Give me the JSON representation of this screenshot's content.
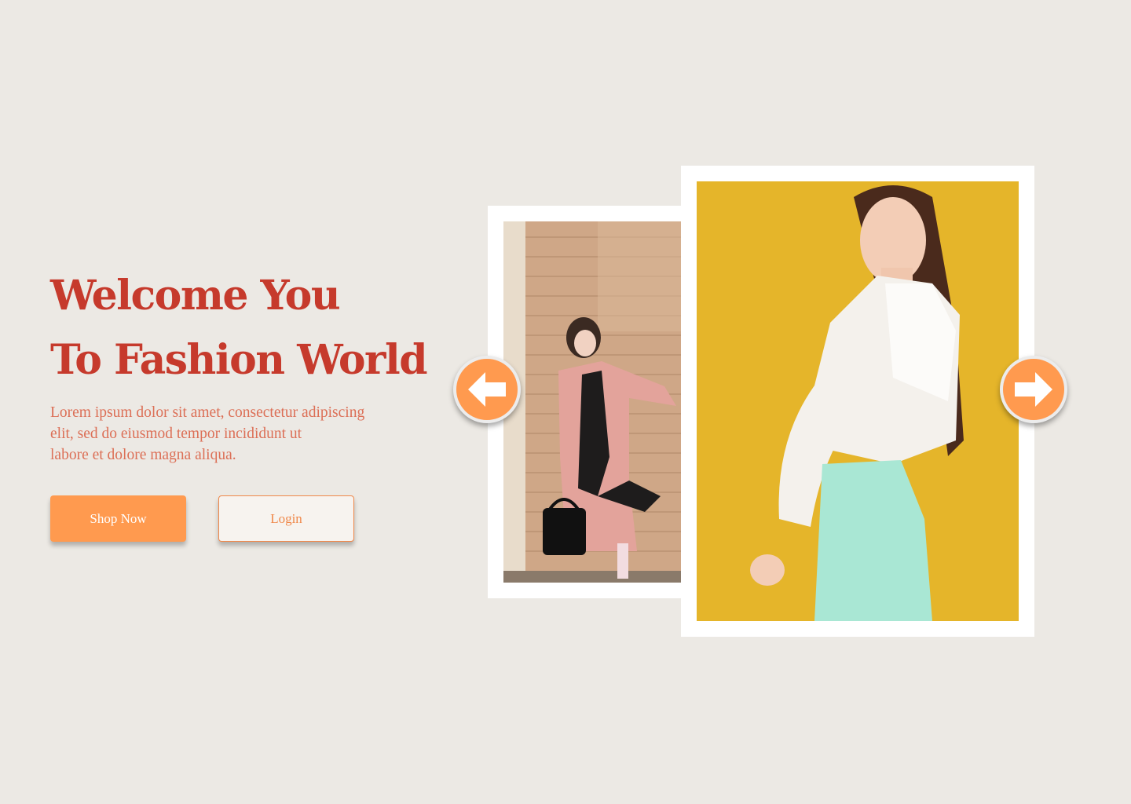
{
  "hero": {
    "title_line1": "Welcome You",
    "title_line2": "To Fashion World",
    "description_lines": [
      "Lorem ipsum dolor sit amet, consectetur adipiscing",
      "elit, sed do eiusmod tempor incididunt ut",
      "labore et dolore magna aliqua."
    ]
  },
  "actions": {
    "shop_label": "Shop Now",
    "login_label": "Login"
  },
  "carousel": {
    "prev_icon": "arrow-left-icon",
    "next_icon": "arrow-right-icon"
  },
  "colors": {
    "background": "#ece9e4",
    "heading": "#c63a2c",
    "body_text": "#dc6f56",
    "accent": "#ff9a4f",
    "photo_left_bg": "#cfa787",
    "photo_right_bg": "#e5b52a"
  }
}
